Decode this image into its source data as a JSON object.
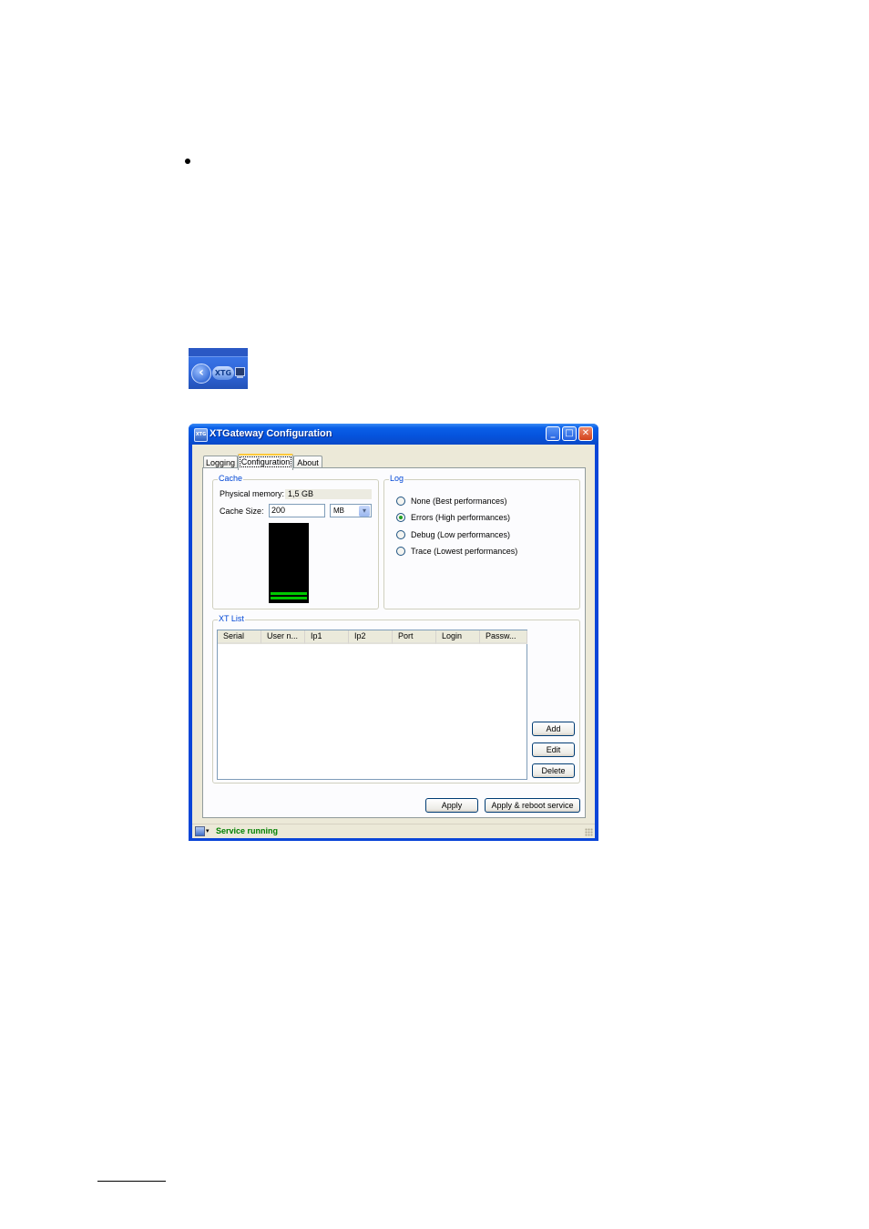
{
  "tray": {
    "badge_text": "XTG",
    "chevron": "‹"
  },
  "window": {
    "title": "XTGateway Configuration",
    "icon_text": "XTG",
    "controls": {
      "minimize": "_",
      "maximize": "□",
      "close": "✕"
    }
  },
  "tabs": [
    {
      "label": "Logging",
      "active": false
    },
    {
      "label": "Configuration",
      "active": true
    },
    {
      "label": "About",
      "active": false
    }
  ],
  "cache": {
    "group_label": "Cache",
    "physical_memory_label": "Physical memory:",
    "physical_memory_value": "1,5 GB",
    "cache_size_label": "Cache Size:",
    "cache_size_value": "200",
    "unit_value": "MB",
    "meter_color": "#00c800"
  },
  "log": {
    "group_label": "Log",
    "options": [
      {
        "label": "None (Best performances)",
        "checked": false
      },
      {
        "label": "Errors (High performances)",
        "checked": true
      },
      {
        "label": "Debug (Low performances)",
        "checked": false
      },
      {
        "label": "Trace (Lowest performances)",
        "checked": false
      }
    ]
  },
  "xt_list": {
    "group_label": "XT List",
    "columns": [
      "Serial",
      "User n...",
      "Ip1",
      "Ip2",
      "Port",
      "Login",
      "Passw..."
    ],
    "rows": [],
    "buttons": {
      "add": "Add",
      "edit": "Edit",
      "delete": "Delete"
    }
  },
  "footer_buttons": {
    "apply": "Apply",
    "apply_reboot": "Apply & reboot service"
  },
  "status_bar": {
    "text": "Service running",
    "text_color": "#008000",
    "dropdown_glyph": "▾"
  }
}
